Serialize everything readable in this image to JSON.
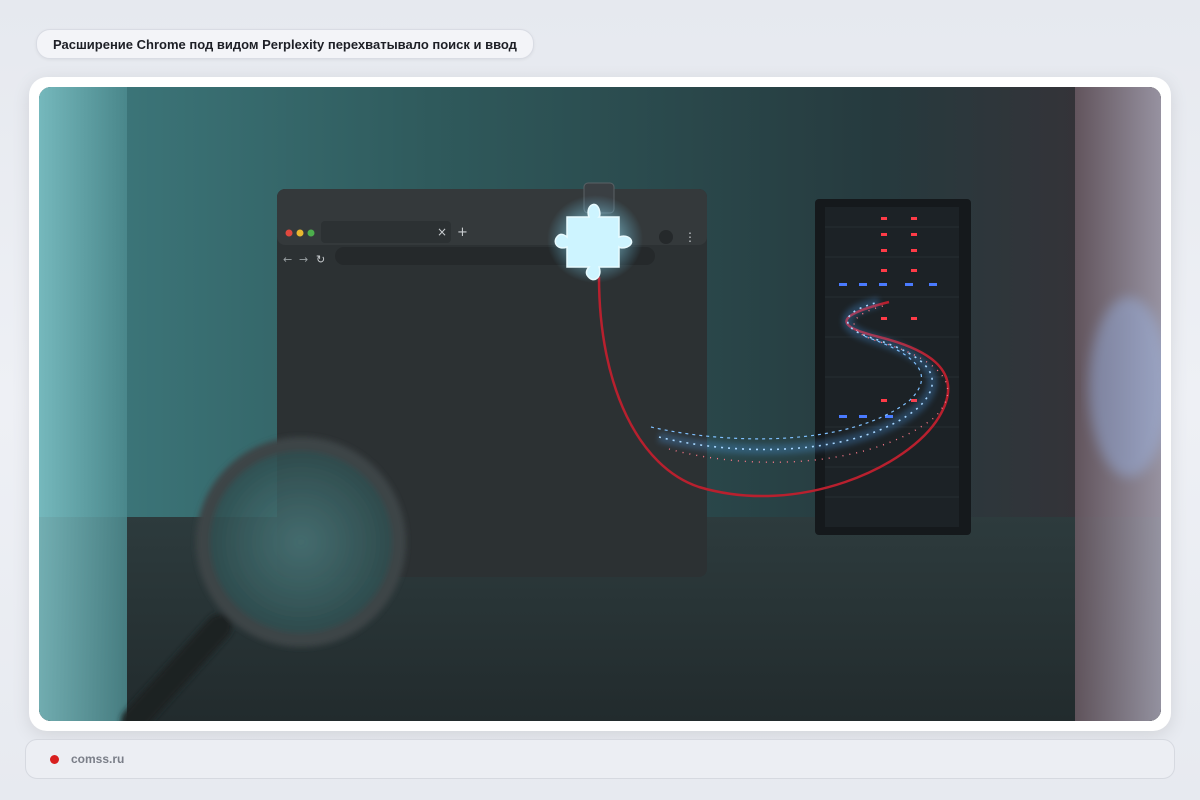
{
  "header": {
    "title": "Расширение Chrome под видом Perplexity перехватывало поиск и ввод"
  },
  "illustration": {
    "browser_tab_close": "×",
    "browser_tab_new": "+",
    "browser_menu": "⋮",
    "icons": [
      "puzzle-piece-icon",
      "magnifying-glass-icon",
      "server-rack-icon",
      "browser-window-icon"
    ]
  },
  "footer": {
    "source": "comss.ru",
    "dot_color": "#d81f1f"
  }
}
